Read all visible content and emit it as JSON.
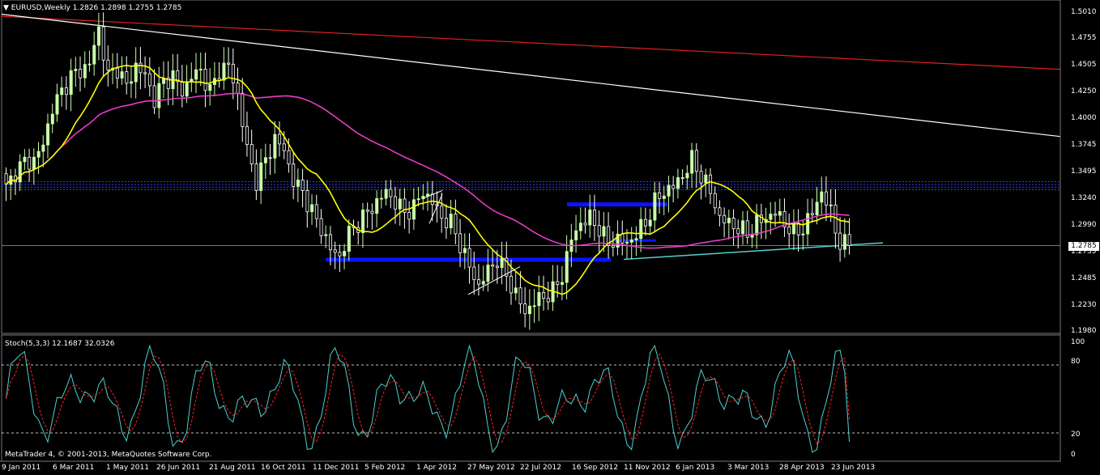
{
  "header": {
    "symbol_text": "EURUSD,Weekly",
    "ohlc_text": "1.2826 1.2898 1.2755 1.2785"
  },
  "price_axis": {
    "ticks": [
      "1.5010",
      "1.4755",
      "1.4505",
      "1.4250",
      "1.4000",
      "1.3745",
      "1.3495",
      "1.3240",
      "1.2990",
      "1.2785",
      "1.2735",
      "1.2485",
      "1.2230",
      "1.1980"
    ],
    "current_price": "1.2785"
  },
  "osc": {
    "label_text": "Stoch(5,3,3) 12.1687 32.0326",
    "levels": [
      "100",
      "80",
      "20",
      "0"
    ],
    "copyright_text": "MetaTrader 4, © 2001-2013, MetaQuotes Software Corp."
  },
  "time_axis": {
    "labels": [
      "9 Jan 2011",
      "6 Mar 2011",
      "1 May 2011",
      "26 Jun 2011",
      "21 Aug 2011",
      "16 Oct 2011",
      "11 Dec 2011",
      "5 Feb 2012",
      "1 Apr 2012",
      "27 May 2012",
      "22 Jul 2012",
      "16 Sep 2012",
      "11 Nov 2012",
      "6 Jan 2013",
      "3 Mar 2013",
      "28 Apr 2013",
      "23 Jun 2013"
    ]
  },
  "colors": {
    "background": "#000000",
    "bull_candle": "#c8ffa8",
    "bear_candle": "#ffffff",
    "ma_fast": "#ffff00",
    "ma_slow": "#e63cc8",
    "trend_red": "#e32020",
    "trend_white": "#ffffff",
    "support_cyan": "#55d0c8",
    "zone_blue": "#0a14ff",
    "stoch_main": "#4fd0d0",
    "stoch_signal": "#ff2020",
    "grid_dash": "#ffffff"
  },
  "chart_data": {
    "type": "candlestick",
    "symbol": "EURUSD",
    "timeframe": "Weekly",
    "last_bar": {
      "open": 1.2826,
      "high": 1.2898,
      "low": 1.2755,
      "close": 1.2785
    },
    "y_range": [
      1.198,
      1.501
    ],
    "x_labels": [
      "9 Jan 2011",
      "6 Mar 2011",
      "1 May 2011",
      "26 Jun 2011",
      "21 Aug 2011",
      "16 Oct 2011",
      "11 Dec 2011",
      "5 Feb 2012",
      "1 Apr 2012",
      "27 May 2012",
      "22 Jul 2012",
      "16 Sep 2012",
      "11 Nov 2012",
      "6 Jan 2013",
      "3 Mar 2013",
      "28 Apr 2013",
      "23 Jun 2013"
    ],
    "close_path": [
      [
        0,
        1.333
      ],
      [
        2,
        1.349
      ],
      [
        4,
        1.358
      ],
      [
        6,
        1.36
      ],
      [
        8,
        1.375
      ],
      [
        10,
        1.41
      ],
      [
        12,
        1.425
      ],
      [
        14,
        1.44
      ],
      [
        16,
        1.445
      ],
      [
        18,
        1.452
      ],
      [
        20,
        1.485
      ],
      [
        22,
        1.44
      ],
      [
        24,
        1.448
      ],
      [
        26,
        1.43
      ],
      [
        28,
        1.45
      ],
      [
        30,
        1.44
      ],
      [
        32,
        1.418
      ],
      [
        34,
        1.435
      ],
      [
        36,
        1.44
      ],
      [
        38,
        1.425
      ],
      [
        40,
        1.44
      ],
      [
        42,
        1.445
      ],
      [
        44,
        1.425
      ],
      [
        46,
        1.445
      ],
      [
        48,
        1.45
      ],
      [
        50,
        1.422
      ],
      [
        52,
        1.37
      ],
      [
        54,
        1.34
      ],
      [
        56,
        1.36
      ],
      [
        58,
        1.38
      ],
      [
        60,
        1.37
      ],
      [
        62,
        1.34
      ],
      [
        64,
        1.33
      ],
      [
        66,
        1.31
      ],
      [
        68,
        1.295
      ],
      [
        70,
        1.275
      ],
      [
        72,
        1.268
      ],
      [
        74,
        1.29
      ],
      [
        76,
        1.3
      ],
      [
        78,
        1.31
      ],
      [
        80,
        1.32
      ],
      [
        82,
        1.33
      ],
      [
        84,
        1.32
      ],
      [
        86,
        1.31
      ],
      [
        88,
        1.315
      ],
      [
        90,
        1.33
      ],
      [
        92,
        1.32
      ],
      [
        94,
        1.305
      ],
      [
        96,
        1.3
      ],
      [
        98,
        1.28
      ],
      [
        100,
        1.258
      ],
      [
        102,
        1.24
      ],
      [
        104,
        1.255
      ],
      [
        106,
        1.265
      ],
      [
        108,
        1.25
      ],
      [
        110,
        1.232
      ],
      [
        112,
        1.215
      ],
      [
        114,
        1.225
      ],
      [
        116,
        1.23
      ],
      [
        118,
        1.235
      ],
      [
        120,
        1.25
      ],
      [
        122,
        1.285
      ],
      [
        124,
        1.3
      ],
      [
        126,
        1.305
      ],
      [
        128,
        1.295
      ],
      [
        130,
        1.28
      ],
      [
        132,
        1.285
      ],
      [
        134,
        1.28
      ],
      [
        136,
        1.29
      ],
      [
        138,
        1.3
      ],
      [
        140,
        1.32
      ],
      [
        142,
        1.33
      ],
      [
        144,
        1.335
      ],
      [
        146,
        1.345
      ],
      [
        148,
        1.36
      ],
      [
        150,
        1.345
      ],
      [
        152,
        1.33
      ],
      [
        154,
        1.305
      ],
      [
        156,
        1.3
      ],
      [
        158,
        1.295
      ],
      [
        160,
        1.29
      ],
      [
        162,
        1.3
      ],
      [
        164,
        1.305
      ],
      [
        166,
        1.31
      ],
      [
        168,
        1.3
      ],
      [
        170,
        1.29
      ],
      [
        172,
        1.295
      ],
      [
        174,
        1.31
      ],
      [
        176,
        1.33
      ],
      [
        178,
        1.31
      ],
      [
        180,
        1.28
      ],
      [
        182,
        1.2785
      ]
    ],
    "indicators": [
      {
        "name": "Stoch(5,3,3)",
        "main": 12.1687,
        "signal": 32.0326,
        "levels": [
          20,
          80
        ]
      }
    ],
    "price_labels_shown": [
      "1.5010",
      "1.4755",
      "1.4505",
      "1.4250",
      "1.4000",
      "1.3745",
      "1.3495",
      "1.3240",
      "1.2990",
      "1.2735",
      "1.2485",
      "1.2230",
      "1.1980"
    ]
  }
}
